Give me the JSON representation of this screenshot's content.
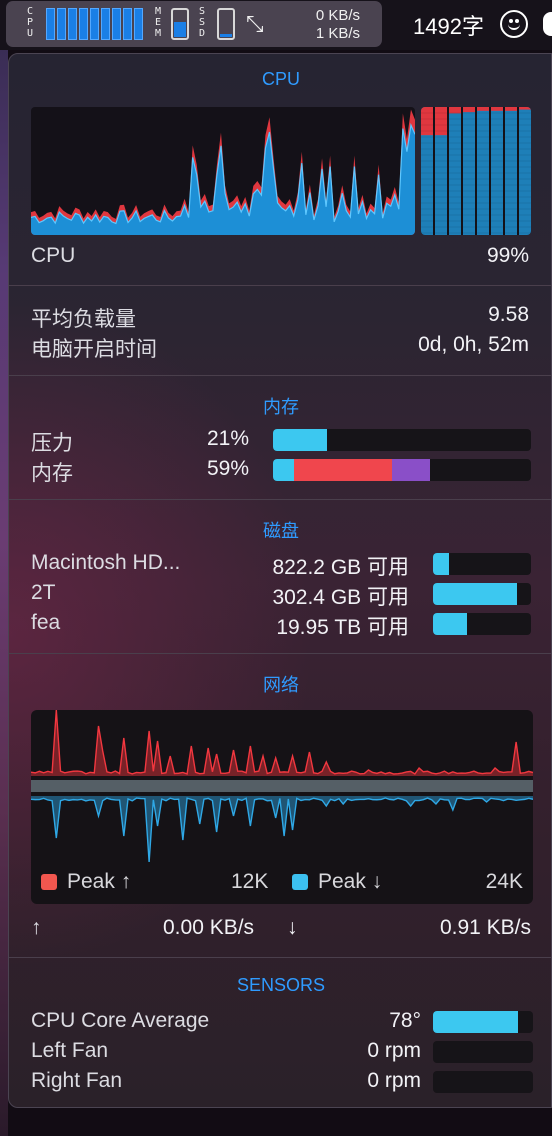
{
  "menubar": {
    "cpu_label": "CPU",
    "mem_label": "MEM",
    "ssd_label": "SSD",
    "cpu_core_count": 9,
    "mem_fill_fraction": 0.55,
    "ssd_fill_fraction": 0.12,
    "swap_icon": "expand-arrows-icon",
    "net_up": "0 KB/s",
    "net_down": "1 KB/s",
    "word_count": "1492字",
    "smiley_icon": "smiley-face-icon"
  },
  "cpu": {
    "title": "CPU",
    "label": "CPU",
    "value": "99%",
    "core_count": 8,
    "colors": {
      "user": "#1d8fd6",
      "system": "#e0373f",
      "core_bg": "#1e7fb8"
    }
  },
  "load": {
    "avg_label": "平均负载量",
    "avg_value": "9.58",
    "uptime_label": "电脑开启时间",
    "uptime_value": "0d, 0h, 52m"
  },
  "memory": {
    "title": "内存",
    "rows": [
      {
        "label": "压力",
        "value": "21%",
        "segments": [
          {
            "fraction": 0.21,
            "color": "#3cc8f0"
          }
        ]
      },
      {
        "label": "内存",
        "value": "59%",
        "segments": [
          {
            "fraction": 0.08,
            "color": "#3cc8f0"
          },
          {
            "fraction": 0.38,
            "color": "#f0464d"
          },
          {
            "fraction": 0.15,
            "color": "#8a4fc8"
          }
        ]
      }
    ]
  },
  "disk": {
    "title": "磁盘",
    "rows": [
      {
        "label": "Macintosh HD...",
        "value": "822.2 GB 可用",
        "fraction": 0.16
      },
      {
        "label": "2T",
        "value": "302.4 GB 可用",
        "fraction": 0.86
      },
      {
        "label": "fea",
        "value": "19.95 TB 可用",
        "fraction": 0.35
      }
    ]
  },
  "network": {
    "title": "网络",
    "legend_up_label": "Peak ↑",
    "legend_up_value": "12K",
    "legend_down_label": "Peak ↓",
    "legend_down_value": "24K",
    "up_arrow": "↑",
    "up_rate": "0.00 KB/s",
    "down_arrow": "↓",
    "down_rate": "0.91 KB/s",
    "colors": {
      "up": "#f2373f",
      "down": "#2fa8e6"
    }
  },
  "sensors": {
    "title": "SENSORS",
    "rows": [
      {
        "label": "CPU Core Average",
        "value": "78°",
        "fraction": 0.85
      },
      {
        "label": "Left Fan",
        "value": "0 rpm",
        "fraction": 0
      },
      {
        "label": "Right Fan",
        "value": "0 rpm",
        "fraction": 0
      }
    ],
    "bar_color": "#3cc8f0"
  }
}
